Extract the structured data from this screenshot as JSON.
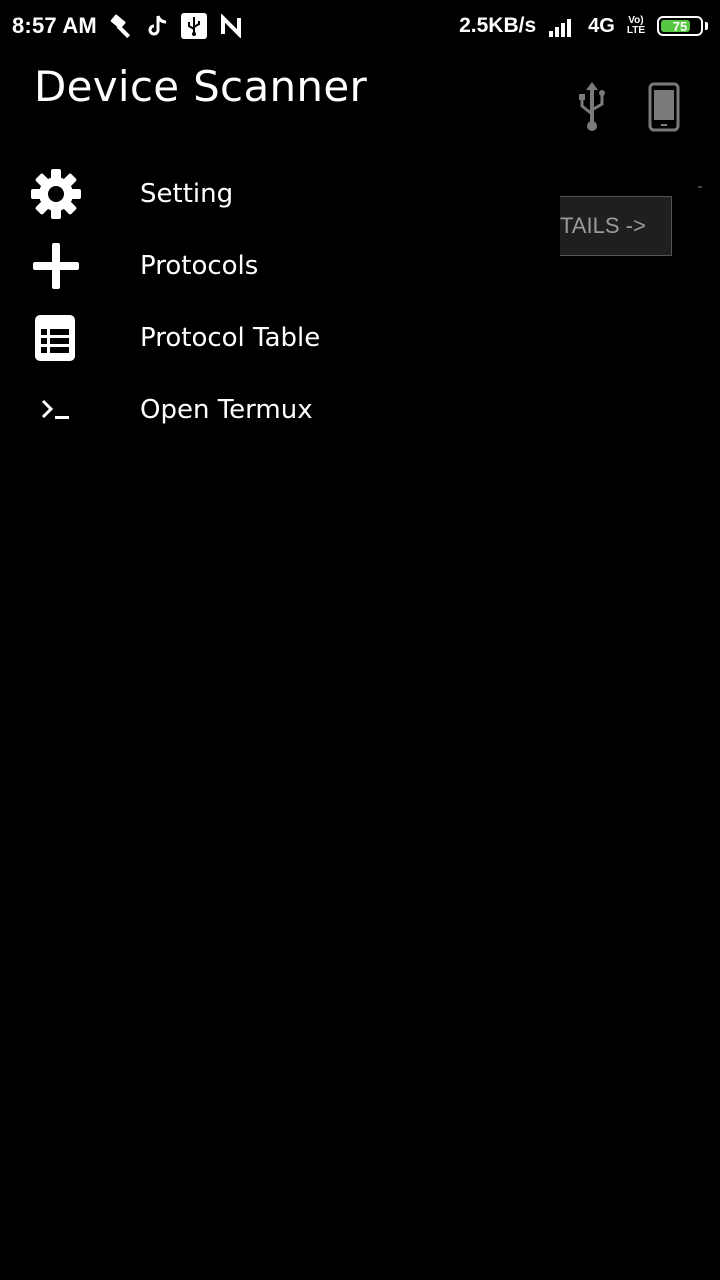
{
  "status_bar": {
    "time": "8:57 AM",
    "network_speed": "2.5KB/s",
    "network_type": "4G",
    "volte_top": "Vo)",
    "volte_bottom": "LTE",
    "battery_level": "75",
    "battery_fraction": 0.75,
    "icons": [
      "hammer-icon",
      "tiktok-icon",
      "usb-icon",
      "n-icon",
      "signal-icon"
    ]
  },
  "background": {
    "details_button_label": "TAILS ->",
    "icons": [
      "usb-icon",
      "phone-icon"
    ]
  },
  "drawer": {
    "title": "Device Scanner",
    "items": [
      {
        "label": "Setting",
        "icon": "gear-icon"
      },
      {
        "label": "Protocols",
        "icon": "plus-icon"
      },
      {
        "label": "Protocol Table",
        "icon": "table-icon"
      },
      {
        "label": "Open Termux",
        "icon": "terminal-icon"
      }
    ]
  },
  "colors": {
    "background": "#000000",
    "text": "#ffffff",
    "battery": "#55c742",
    "muted": "#9a9a9a"
  }
}
